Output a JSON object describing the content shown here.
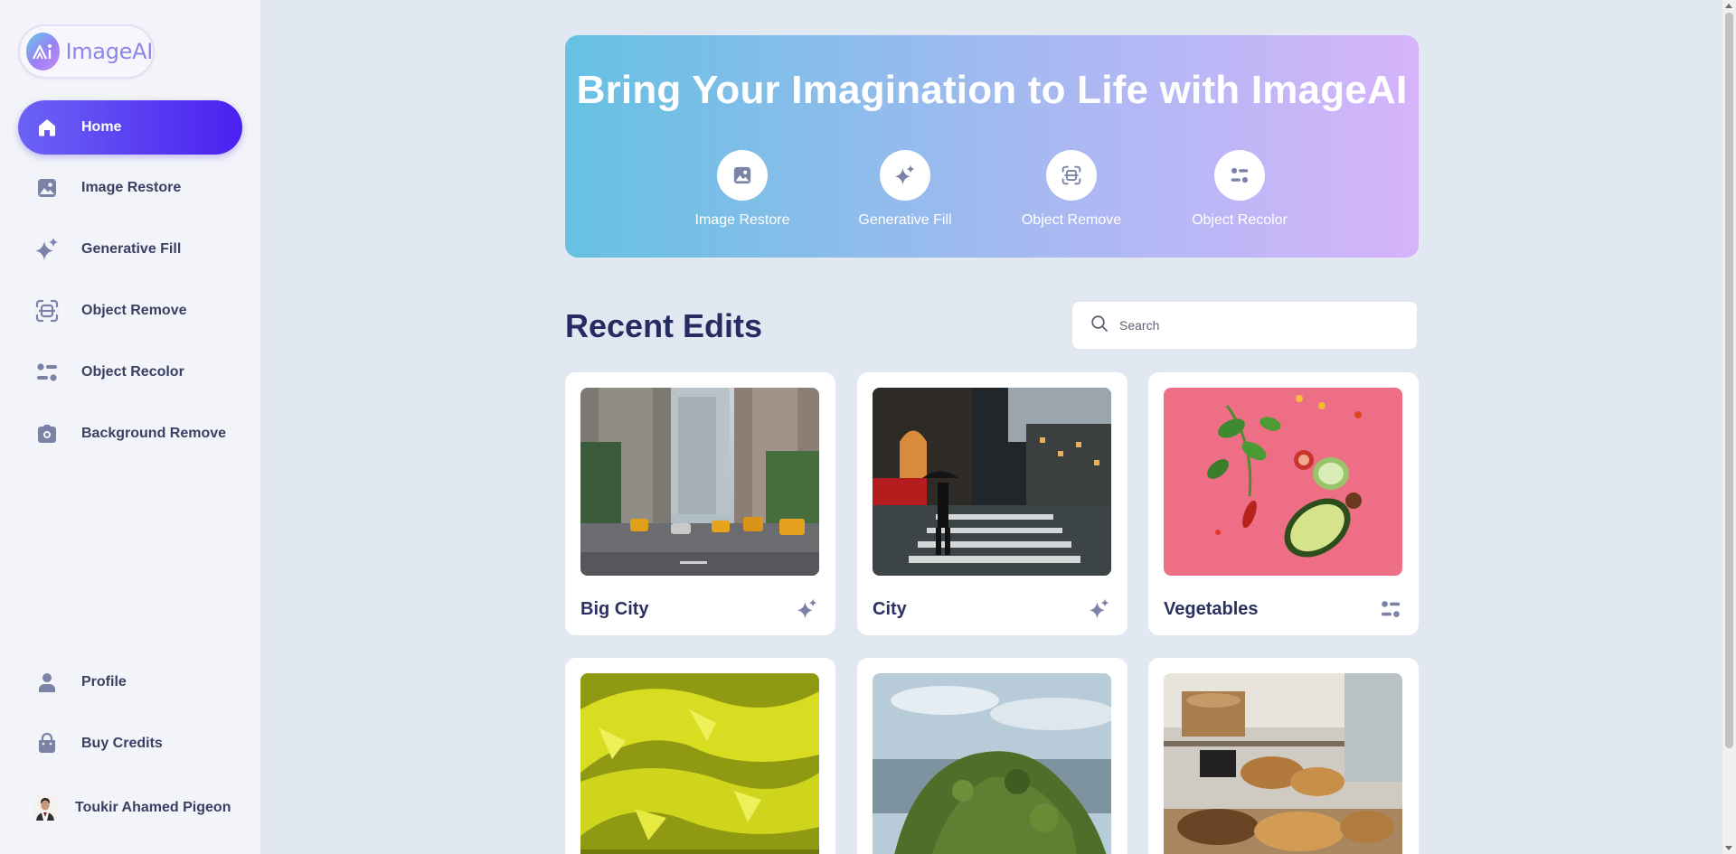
{
  "brand": {
    "name": "ImageAI",
    "icon": "logo-icon"
  },
  "sidebar": {
    "items": [
      {
        "label": "Home",
        "icon": "home-icon",
        "active": true
      },
      {
        "label": "Image Restore",
        "icon": "image-icon",
        "active": false
      },
      {
        "label": "Generative Fill",
        "icon": "sparkles-icon",
        "active": false
      },
      {
        "label": "Object Remove",
        "icon": "scan-icon",
        "active": false
      },
      {
        "label": "Object Recolor",
        "icon": "sliders-icon",
        "active": false
      },
      {
        "label": "Background Remove",
        "icon": "camera-icon",
        "active": false
      }
    ],
    "bottom_items": [
      {
        "label": "Profile",
        "icon": "user-icon"
      },
      {
        "label": "Buy Credits",
        "icon": "bag-icon"
      }
    ],
    "user": {
      "name": "Toukir Ahamed Pigeon"
    }
  },
  "hero": {
    "title": "Bring Your Imagination to Life with ImageAI",
    "tools": [
      {
        "label": "Image Restore",
        "icon": "image-icon"
      },
      {
        "label": "Generative Fill",
        "icon": "sparkles-icon"
      },
      {
        "label": "Object Remove",
        "icon": "scan-icon"
      },
      {
        "label": "Object Recolor",
        "icon": "sliders-icon"
      }
    ]
  },
  "recent": {
    "title": "Recent Edits",
    "search_placeholder": "Search",
    "cards": [
      {
        "title": "Big City",
        "icon": "sparkles-icon"
      },
      {
        "title": "City",
        "icon": "sparkles-icon"
      },
      {
        "title": "Vegetables",
        "icon": "sliders-icon"
      },
      {
        "title": "",
        "icon": ""
      },
      {
        "title": "",
        "icon": ""
      },
      {
        "title": "",
        "icon": ""
      }
    ]
  },
  "colors": {
    "accent": "#4b20f0",
    "accent_light": "#6b63f5",
    "text_dark": "#252c61",
    "icon_gray": "#7a82a6",
    "background": "#e2e8f1"
  }
}
